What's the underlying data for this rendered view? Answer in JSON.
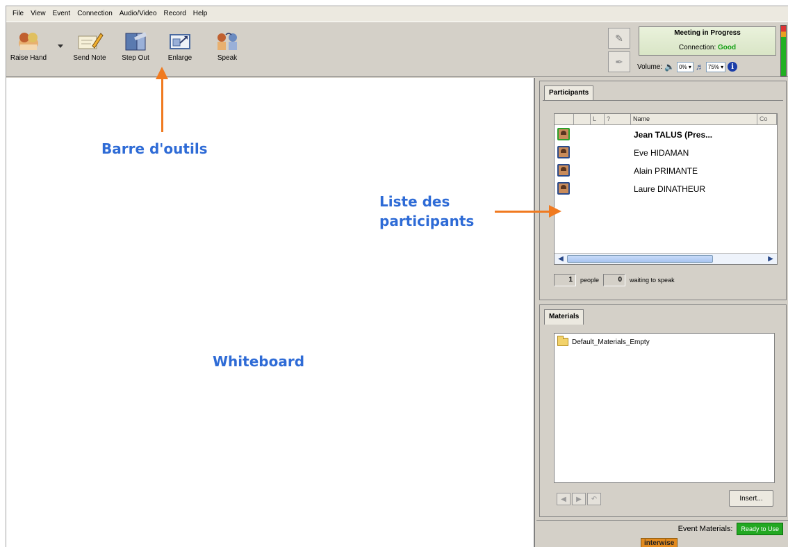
{
  "menu": [
    "File",
    "View",
    "Event",
    "Connection",
    "Audio/Video",
    "Record",
    "Help"
  ],
  "toolbar": {
    "raise_hand": "Raise Hand",
    "send_note": "Send Note",
    "step_out": "Step Out",
    "enlarge": "Enlarge",
    "speak": "Speak"
  },
  "status": {
    "title": "Meeting in Progress",
    "connection_label": "Connection:",
    "connection_value": "Good",
    "volume_label": "Volume:",
    "speaker_level": "0%",
    "mic_level": "75%"
  },
  "participants": {
    "tab": "Participants",
    "col_l": "L",
    "col_q": "?",
    "col_name": "Name",
    "col_extra": "Co",
    "rows": [
      "Jean TALUS (Pres...",
      "Eve HIDAMAN",
      "Alain PRIMANTE",
      "Laure DINATHEUR"
    ],
    "people_count": "1",
    "people_label": "people",
    "waiting_count": "0",
    "waiting_label": "waiting to speak"
  },
  "materials": {
    "tab": "Materials",
    "items": [
      "Default_Materials_Empty"
    ],
    "insert_label": "Insert..."
  },
  "footer": {
    "event_materials_label": "Event Materials:",
    "ready_label": "Ready to Use",
    "brand": "interwise"
  },
  "annotations": {
    "toolbar": "Barre d'outils",
    "participants_line1": "Liste des",
    "participants_line2": "participants",
    "whiteboard": "Whiteboard"
  },
  "colors": {
    "annotation_text": "#2e6bd6",
    "annotation_arrow": "#f07a20",
    "connection_good": "#14a014",
    "ready_badge": "#22a822"
  }
}
